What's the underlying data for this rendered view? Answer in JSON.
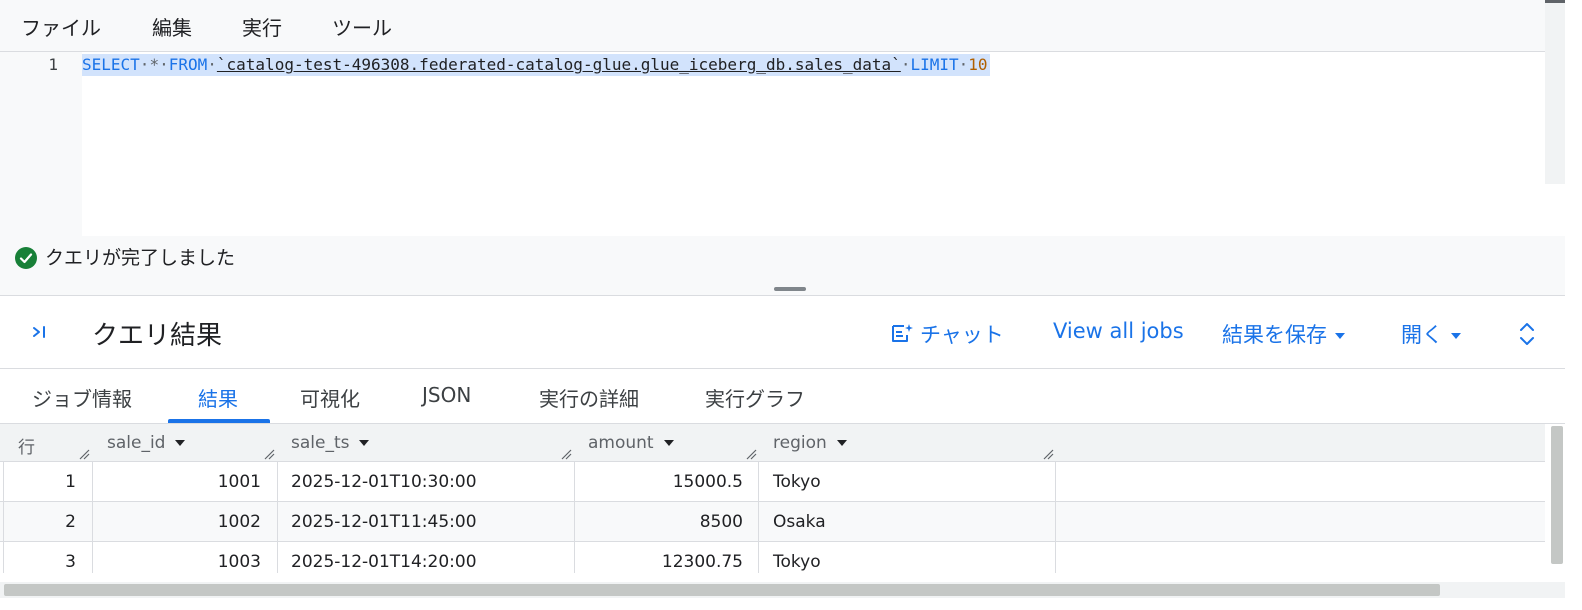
{
  "menu": {
    "items": [
      {
        "label": "ファイル"
      },
      {
        "label": "編集"
      },
      {
        "label": "実行"
      },
      {
        "label": "ツール"
      }
    ]
  },
  "editor": {
    "line_number": "1",
    "tokens": {
      "select": "SELECT",
      "star": "*",
      "from": "FROM",
      "table": "`catalog-test-496308.federated-catalog-glue.glue_iceberg_db.sales_data`",
      "limit": "LIMIT",
      "limit_value": "10"
    }
  },
  "status": {
    "text": "クエリが完了しました",
    "color": "#188038"
  },
  "results": {
    "title": "クエリ結果",
    "buttons": {
      "chat": "チャット",
      "view_all_jobs": "View all jobs",
      "save_results": "結果を保存",
      "open": "開く"
    }
  },
  "tabs": [
    {
      "label": "ジョブ情報"
    },
    {
      "label": "結果",
      "active": true
    },
    {
      "label": "可視化"
    },
    {
      "label": "JSON"
    },
    {
      "label": "実行の詳細"
    },
    {
      "label": "実行グラフ"
    }
  ],
  "table": {
    "columns": [
      "行",
      "sale_id",
      "sale_ts",
      "amount",
      "region"
    ],
    "rows": [
      [
        "1",
        "1001",
        "2025-12-01T10:30:00",
        "15000.5",
        "Tokyo"
      ],
      [
        "2",
        "1002",
        "2025-12-01T11:45:00",
        "8500",
        "Osaka"
      ],
      [
        "3",
        "1003",
        "2025-12-01T14:20:00",
        "12300.75",
        "Tokyo"
      ]
    ]
  },
  "colors": {
    "accent": "#1a73e8",
    "success": "#188038"
  }
}
